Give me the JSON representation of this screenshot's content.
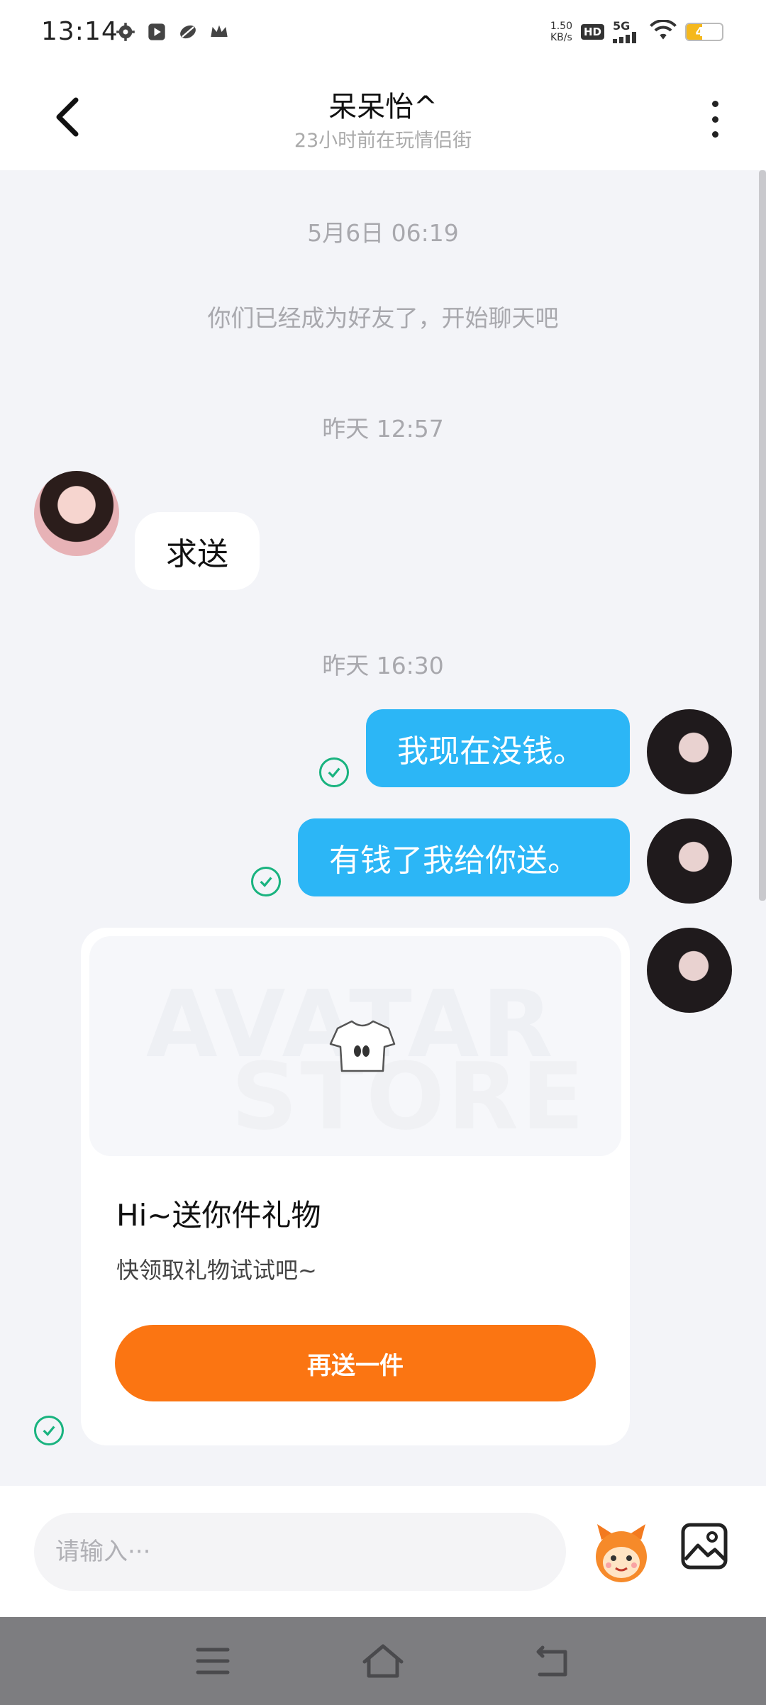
{
  "status_bar": {
    "time": "13:14",
    "net_speed_value": "1.50",
    "net_speed_unit": "KB/s",
    "hd": "HD",
    "network": "5G",
    "battery": "44",
    "battery_level_percent": 44,
    "left_icons": [
      "gear-icon",
      "play-icon",
      "leaf-icon",
      "crown-icon"
    ]
  },
  "header": {
    "title": "呆呆怡^",
    "subtitle": "23小时前在玩情侣街"
  },
  "chat": {
    "timestamp_1": "5月6日 06:19",
    "system_message": "你们已经成为好友了，开始聊天吧",
    "timestamp_2": "昨天 12:57",
    "incoming_1": "求送",
    "timestamp_3": "昨天 16:30",
    "outgoing_1": "我现在没钱。",
    "outgoing_2": "有钱了我给你送。",
    "gift_card": {
      "watermark_line1": "AVATAR",
      "watermark_line2": "STORE",
      "title": "Hi~送你件礼物",
      "desc": "快领取礼物试试吧~",
      "button": "再送一件"
    }
  },
  "input_bar": {
    "placeholder": "请输入···"
  },
  "colors": {
    "outgoing_bubble": "#2cb6f6",
    "gift_button": "#fb7512",
    "read_check": "#19b37f",
    "background": "#f3f4f8"
  }
}
